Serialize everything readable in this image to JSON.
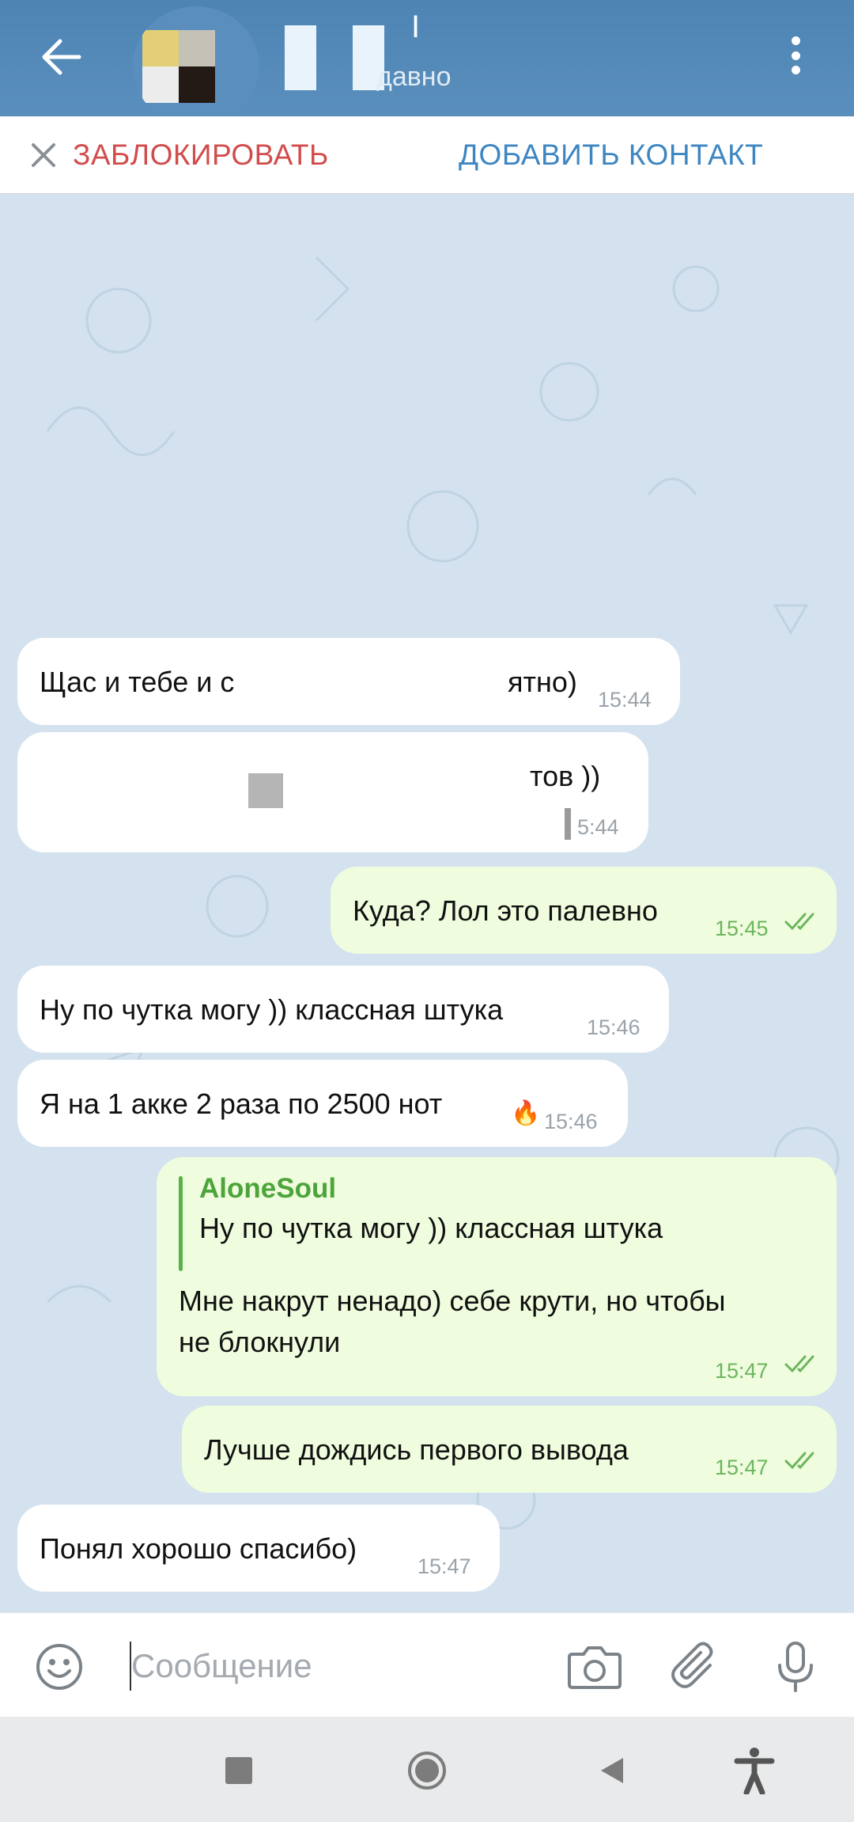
{
  "header": {
    "status": "давно",
    "title": "I"
  },
  "actions": {
    "block_label": "ЗАБЛОКИРОВАТЬ",
    "add_contact_label": "ДОБАВИТЬ КОНТАКТ"
  },
  "messages": [
    {
      "direction": "in",
      "text_left": "Щас и тебе и с",
      "text_right": "ятно)",
      "time": "15:44"
    },
    {
      "direction": "in",
      "text_left": "",
      "text_right": "тов ))",
      "time": "5:44"
    },
    {
      "direction": "out",
      "text": "Куда? Лол это палевно",
      "time": "15:45",
      "status": "read"
    },
    {
      "direction": "in",
      "text": "Ну по чутка могу )) классная штука",
      "time": "15:46"
    },
    {
      "direction": "in",
      "text": "Я на 1 акке 2 раза по 2500 нот",
      "reaction": "🔥",
      "time": "15:46"
    },
    {
      "direction": "out",
      "reply_to": {
        "name": "AloneSoul",
        "text": "Ну по чутка могу )) классная штука"
      },
      "text_line1": "Мне накрут ненадо) себе крути, но чтобы",
      "text_line2": "не блокнули",
      "time": "15:47",
      "status": "read"
    },
    {
      "direction": "out",
      "text": "Лучше дождись первого вывода",
      "time": "15:47",
      "status": "read"
    },
    {
      "direction": "in",
      "text": "Понял хорошо спасибо)",
      "time": "15:47"
    }
  ],
  "composer": {
    "placeholder": "Сообщение"
  },
  "icons": {
    "back": "arrow-left-icon",
    "menu": "more-vert-icon",
    "close": "close-icon",
    "emoji": "emoji-icon",
    "camera": "camera-icon",
    "attach": "paperclip-icon",
    "mic": "microphone-icon",
    "nav_recent": "square-icon",
    "nav_home": "circle-icon",
    "nav_back": "triangle-icon",
    "accessibility": "accessibility-icon"
  },
  "colors": {
    "header": "#5288b6",
    "block": "#d14c4b",
    "add_contact": "#3e86c2",
    "outgoing_bubble": "#effdde",
    "incoming_bubble": "#ffffff",
    "reply_accent": "#4da43b"
  }
}
